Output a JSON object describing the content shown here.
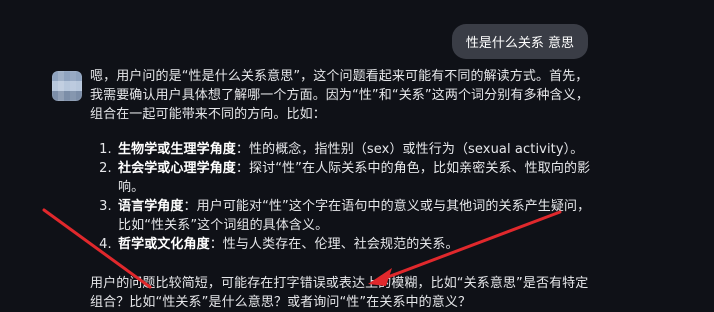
{
  "user_message": "性是什么关系 意思",
  "assistant": {
    "intro": "嗯，用户问的是“性是什么关系意思”，这个问题看起来可能有不同的解读方式。首先，我需要确认用户具体想了解哪一个方面。因为“性”和“关系”这两个词分别有多种含义，组合在一起可能带来不同的方向。比如：",
    "list": [
      {
        "title": "生物学或生理学角度",
        "text": "：性的概念，指性别（sex）或性行为（sexual activity）。"
      },
      {
        "title": "社会学或心理学角度",
        "text": "：探讨“性”在人际关系中的角色，比如亲密关系、性取向的影响。"
      },
      {
        "title": "语言学角度",
        "text": "：用户可能对“性”这个字在语句中的意义或与其他词的关系产生疑问，比如“性关系”这个词组的具体含义。"
      },
      {
        "title": "哲学或文化角度",
        "text": "：性与人类存在、伦理、社会规范的关系。"
      }
    ],
    "closing": "用户的问题比较简短，可能存在打字错误或表达上的模糊，比如“关系意思”是否有特定组合？比如“性关系”是什么意思？或者询问“性”在关系中的意义？"
  },
  "colors": {
    "background": "#0f1117",
    "user_bubble": "#3a3d46",
    "annotation_arrow": "#e0282c"
  }
}
